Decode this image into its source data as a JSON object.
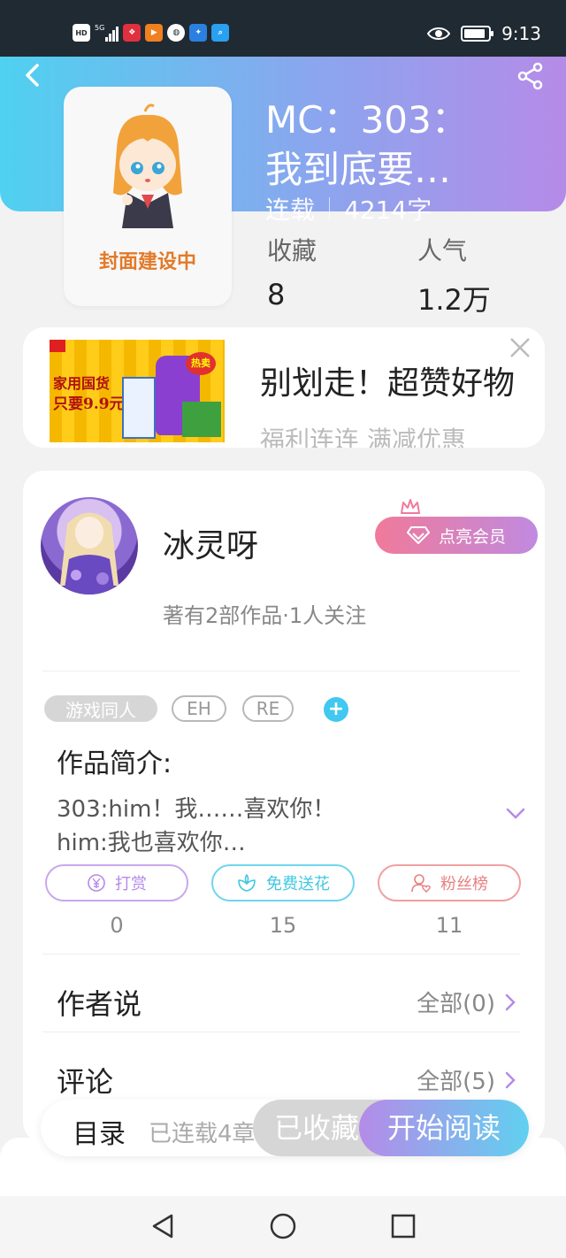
{
  "status_bar": {
    "time": "9:13",
    "badges": [
      "HD",
      "5G"
    ],
    "notification_icons": [
      "hd-icon",
      "signal-5g-icon",
      "gift-app-icon",
      "video-app-icon",
      "browser-app-icon",
      "bulb-app-icon",
      "search-app-icon"
    ]
  },
  "book": {
    "title_line1": "MC：303：",
    "title_line2": "我到底要…",
    "status": "连载",
    "word_count": "4214字",
    "cover_placeholder": "封面建设中",
    "favorites_label": "收藏",
    "favorites_value": "8",
    "popularity_label": "人气",
    "popularity_value": "1.2万"
  },
  "ad": {
    "image_line1": "家用国货",
    "image_line2": "只要9.9元",
    "image_badge": "热卖",
    "title": "别划走！超赞好物",
    "subtitle": "福利连连 满减优惠"
  },
  "author": {
    "name": "冰灵呀",
    "meta": "著有2部作品·1人关注",
    "vip_label": "点亮会员"
  },
  "tags": [
    "游戏同人",
    "EH",
    "RE"
  ],
  "intro": {
    "title": "作品简介:",
    "line1": "303:him！我……喜欢你！",
    "line2": "him:我也喜欢你…"
  },
  "actions": [
    {
      "label": "打赏",
      "count": "0",
      "color": "#c08ae0"
    },
    {
      "label": "免费送花",
      "count": "15",
      "color": "#40c8e0"
    },
    {
      "label": "粉丝榜",
      "count": "11",
      "color": "#e88080"
    }
  ],
  "sections": {
    "author_says_label": "作者说",
    "author_says_link": "全部(0)",
    "comments_label": "评论",
    "comments_link": "全部(5)"
  },
  "bottom_bar": {
    "toc_label": "目录",
    "toc_sub": "已连载4章",
    "favorited_label": "已收藏",
    "read_label": "开始阅读"
  },
  "colors": {
    "header_gradient_start": "#4fd1f0",
    "header_gradient_end": "#b58be8",
    "accent_purple": "#b58be8",
    "accent_blue": "#40c8f0"
  }
}
